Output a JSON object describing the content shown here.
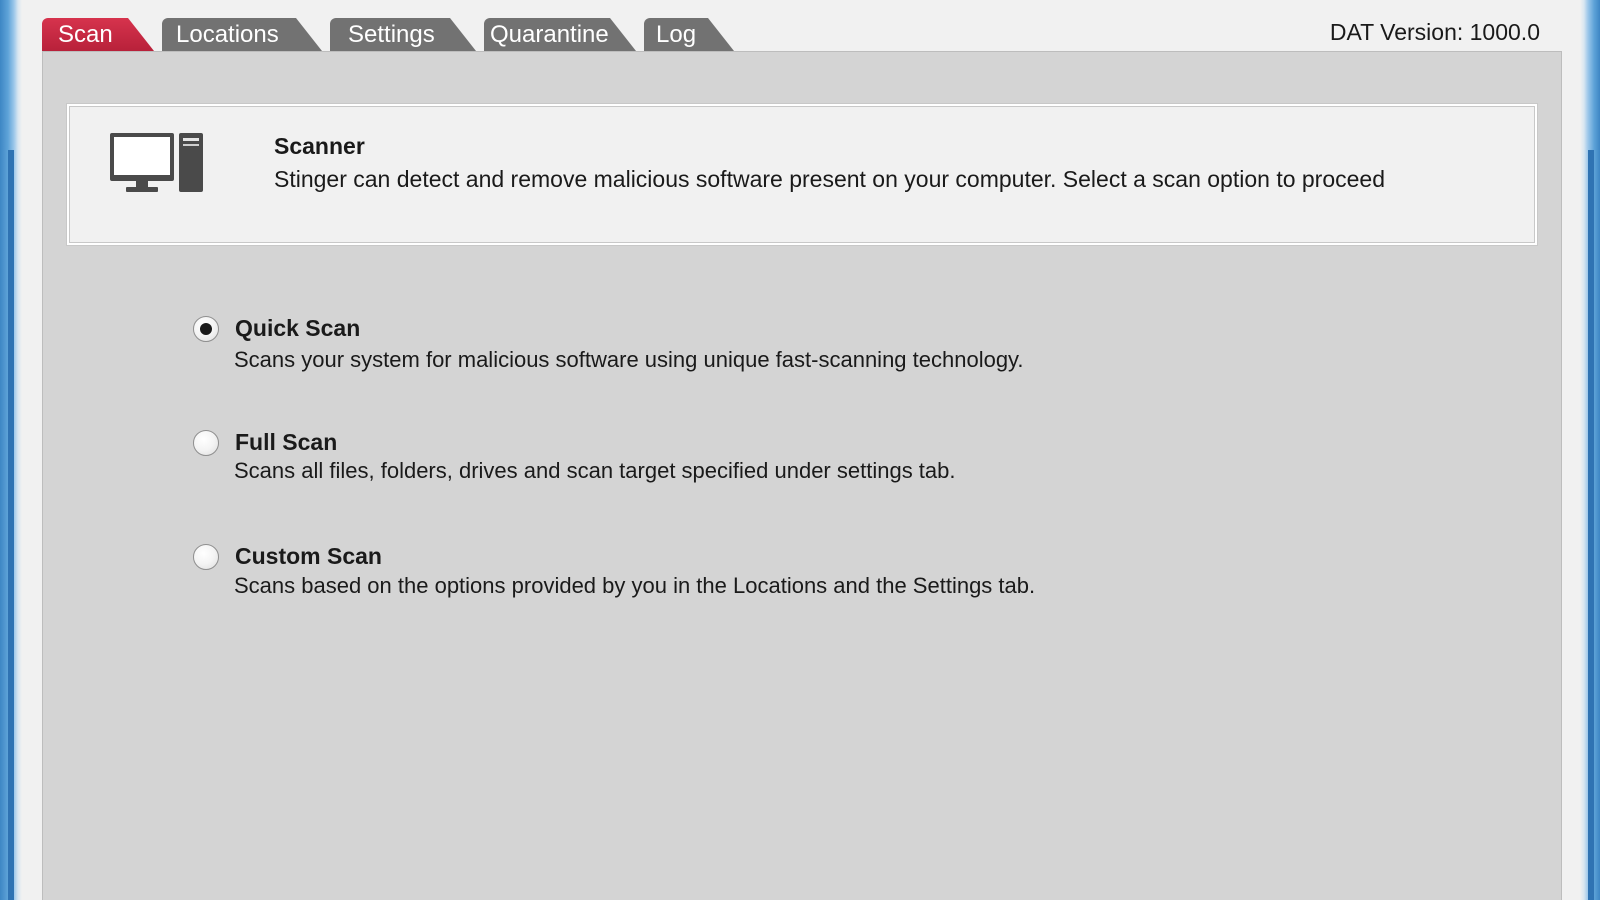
{
  "tabs": [
    {
      "label": "Scan",
      "active": true
    },
    {
      "label": "Locations",
      "active": false
    },
    {
      "label": "Settings",
      "active": false
    },
    {
      "label": "Quarantine",
      "active": false
    },
    {
      "label": "Log",
      "active": false
    }
  ],
  "dat_version": {
    "label": "DAT Version:",
    "value": "1000.0"
  },
  "scanner_info": {
    "title": "Scanner",
    "description": "Stinger can detect and remove malicious software present on your computer. Select a scan option to proceed",
    "icon": "computer-icon"
  },
  "scan_options": [
    {
      "label": "Quick Scan",
      "description": "Scans your system for malicious software using unique fast-scanning technology.",
      "selected": true
    },
    {
      "label": "Full Scan",
      "description": "Scans all files, folders, drives and scan target specified under settings tab.",
      "selected": false
    },
    {
      "label": "Custom Scan",
      "description": "Scans based on the options provided by you in the Locations and the Settings tab.",
      "selected": false
    }
  ],
  "colors": {
    "active_tab": "#c72a43",
    "inactive_tab": "#727272",
    "panel_background": "#d4d4d4",
    "frame_blue": "#3d86c4"
  }
}
